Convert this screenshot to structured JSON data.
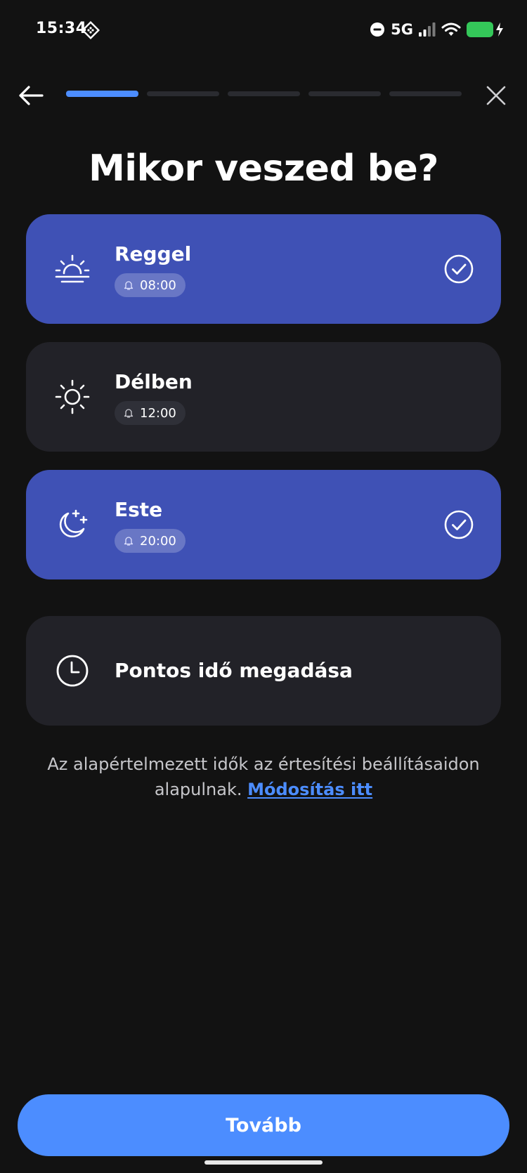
{
  "status_bar": {
    "time": "15:34",
    "network": "5G",
    "icons": [
      "app-icon",
      "dnd-icon",
      "signal-icon",
      "wifi-icon",
      "battery-charging-icon"
    ]
  },
  "nav": {
    "progress_total": 5,
    "progress_current": 1,
    "icons": [
      "back-arrow-icon",
      "close-icon"
    ]
  },
  "title": "Mikor veszed be?",
  "options": [
    {
      "label": "Reggel",
      "time": "08:00",
      "selected": true,
      "icon": "sunrise-icon"
    },
    {
      "label": "Délben",
      "time": "12:00",
      "selected": false,
      "icon": "sun-icon"
    },
    {
      "label": "Este",
      "time": "20:00",
      "selected": true,
      "icon": "moon-stars-icon"
    },
    {
      "label": "Pontos idő megadása",
      "selected": false,
      "icon": "clock-icon"
    }
  ],
  "info": {
    "text": "Az alapértelmezett idők az értesítési beállításaidon alapulnak.",
    "link": "Módosítás itt"
  },
  "continue_label": "Tovább",
  "colors": {
    "background": "#121212",
    "card": "#222228",
    "selected_card": "#3f51b5",
    "accent": "#4c8dff"
  }
}
